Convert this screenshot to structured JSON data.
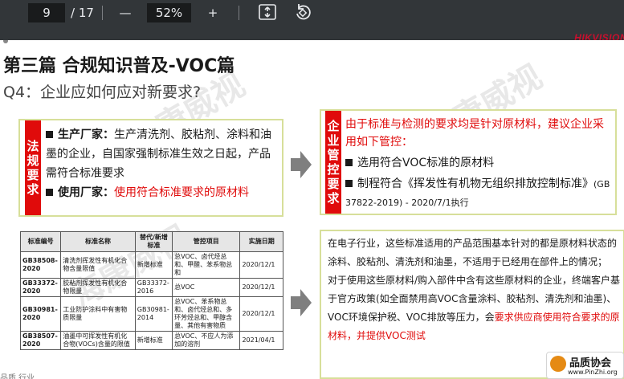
{
  "toolbar": {
    "page_current": "9",
    "page_total": "/ 17",
    "zoom_out_glyph": "—",
    "zoom_value": "52%",
    "zoom_in_glyph": "+",
    "fit_icon": "fit-page-icon",
    "rotate_icon": "rotate-icon",
    "logo": "HIKVISION"
  },
  "slide": {
    "title": "第三篇  合规知识普及-VOC篇",
    "subtitle": "Q4：企业应如何应对新要求?",
    "watermark": "海康威视",
    "left_panel": {
      "label_chars": [
        "法",
        "规",
        "要",
        "求"
      ],
      "b1_lead": "生产厂家：",
      "b1_text": "生产清洗剂、胶粘剂、涂料和油墨的企业，自国家强制标准生效之日起，产品需符合标准要求",
      "b2_lead": "使用厂家：",
      "b2_text": "使用符合标准要求的原材料"
    },
    "right_panel": {
      "label_chars": [
        "企",
        "业",
        "管",
        "控",
        "要",
        "求"
      ],
      "heading": "由于标准与检测的要求均是针对原材料，建议企业采用如下管控：",
      "b1": "选用符合VOC标准的原材料",
      "b2_main": "制程符合《挥发性有机物无组织排放控制标准》",
      "b2_small": "(GB 37822-2019) - 2020/7/1执行"
    },
    "table": {
      "headers": [
        "标准编号",
        "标准名称",
        "替代/新增标准",
        "管控项目",
        "实施日期"
      ],
      "rows": [
        [
          "GB38508-2020",
          "清洗剂挥发性有机化合物含量限值",
          "新增标准",
          "总VOC、卤代烃总和、甲醛、苯系物总和",
          "2020/12/1"
        ],
        [
          "GB33372-2020",
          "胶粘剂挥发性有机化合物限量",
          "GB33372-2016",
          "总VOC",
          "2020/12/1"
        ],
        [
          "GB30981-2020",
          "工业防护涂料中有害物质限量",
          "GB30981-2014",
          "总VOC、苯系物总和、卤代烃总和、多环芳烃总和、甲醇含量、其他有害物质",
          "2020/12/1"
        ],
        [
          "GB38507-2020",
          "油墨中可挥发性有机化合物(VOCs)含量的限值",
          "新增标准",
          "总VOC、不应人为添加的溶剂",
          "2021/04/1"
        ]
      ]
    },
    "right_box": {
      "p1": "在电子行业，这些标准适用的产品范围基本针对的都是原材料状态的涂料、胶粘剂、清洗剂和油墨，不适用于已经用在部件上的情况；",
      "p2_black": "对于使用这些原材料/购入部件中含有这些原材料的企业，终端客户基于官方政策(如全面禁用高VOC含量涂料、胶粘剂、清洗剂和油墨)、VOC环境保护税、VOC排放等压力，会",
      "p2_red": "要求供应商使用符合要求的原材料，并提供VOC测试"
    },
    "footer_left": "品质  行业",
    "badge": {
      "title": "品质协会",
      "url": "www.PinZhi.org"
    }
  },
  "colors": {
    "accent_red": "#e00b0b",
    "panel_border": "#d7df9a",
    "toolbar_bg": "#323639"
  }
}
